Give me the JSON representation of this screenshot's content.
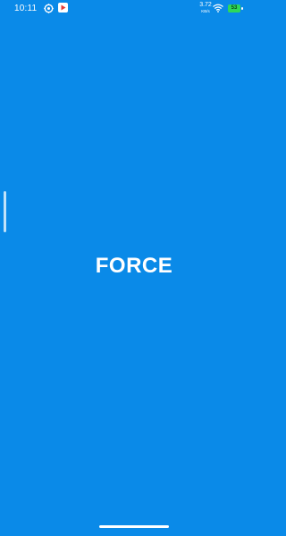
{
  "status_bar": {
    "time": "10:11",
    "net_speed_value": "3.72",
    "net_speed_unit": "KB/s",
    "battery_level": "53",
    "icons": [
      "settings-icon",
      "play-store-icon",
      "wifi-icon",
      "battery-icon"
    ]
  },
  "splash": {
    "title": "FORCE"
  },
  "colors": {
    "background": "#0a8ae8",
    "text": "#ffffff",
    "battery": "#2ed85a"
  }
}
